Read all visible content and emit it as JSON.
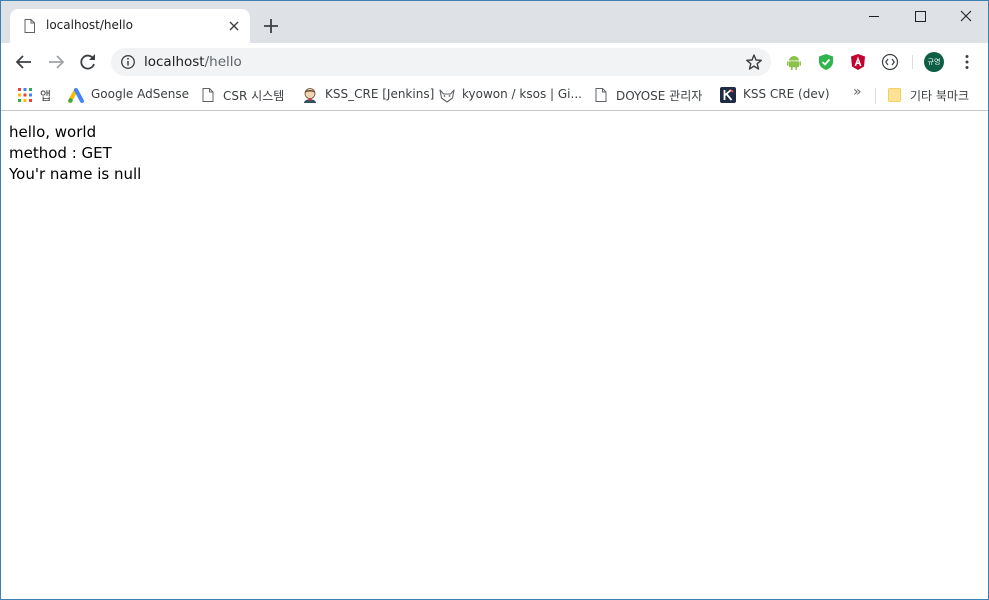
{
  "tab": {
    "title": "localhost/hello"
  },
  "omnibox": {
    "host": "localhost",
    "path": "/hello"
  },
  "bookmarks": [
    {
      "label": "앱",
      "icon": "apps-grid-icon"
    },
    {
      "label": "Google AdSense",
      "icon": "adsense-icon"
    },
    {
      "label": "CSR 시스템",
      "icon": "page-icon"
    },
    {
      "label": "KSS_CRE [Jenkins]",
      "icon": "jenkins-icon"
    },
    {
      "label": "kyowon / ksos | Gi...",
      "icon": "gitlab-fox-icon"
    },
    {
      "label": "DOYOSE 관리자",
      "icon": "page-icon"
    },
    {
      "label": "KSS CRE (dev)",
      "icon": "k-icon"
    }
  ],
  "bookmarks_more": "»",
  "other_bookmarks": {
    "label": "기타 북마크",
    "icon": "folder-icon"
  },
  "profile": {
    "label": "규영"
  },
  "page": {
    "line1": "hello, world",
    "line2": "method : GET",
    "line3": "You'r name is null"
  },
  "colors": {
    "tabstrip": "#dee1e6",
    "omnibox": "#f1f3f4",
    "profile": "#0d5e45"
  }
}
